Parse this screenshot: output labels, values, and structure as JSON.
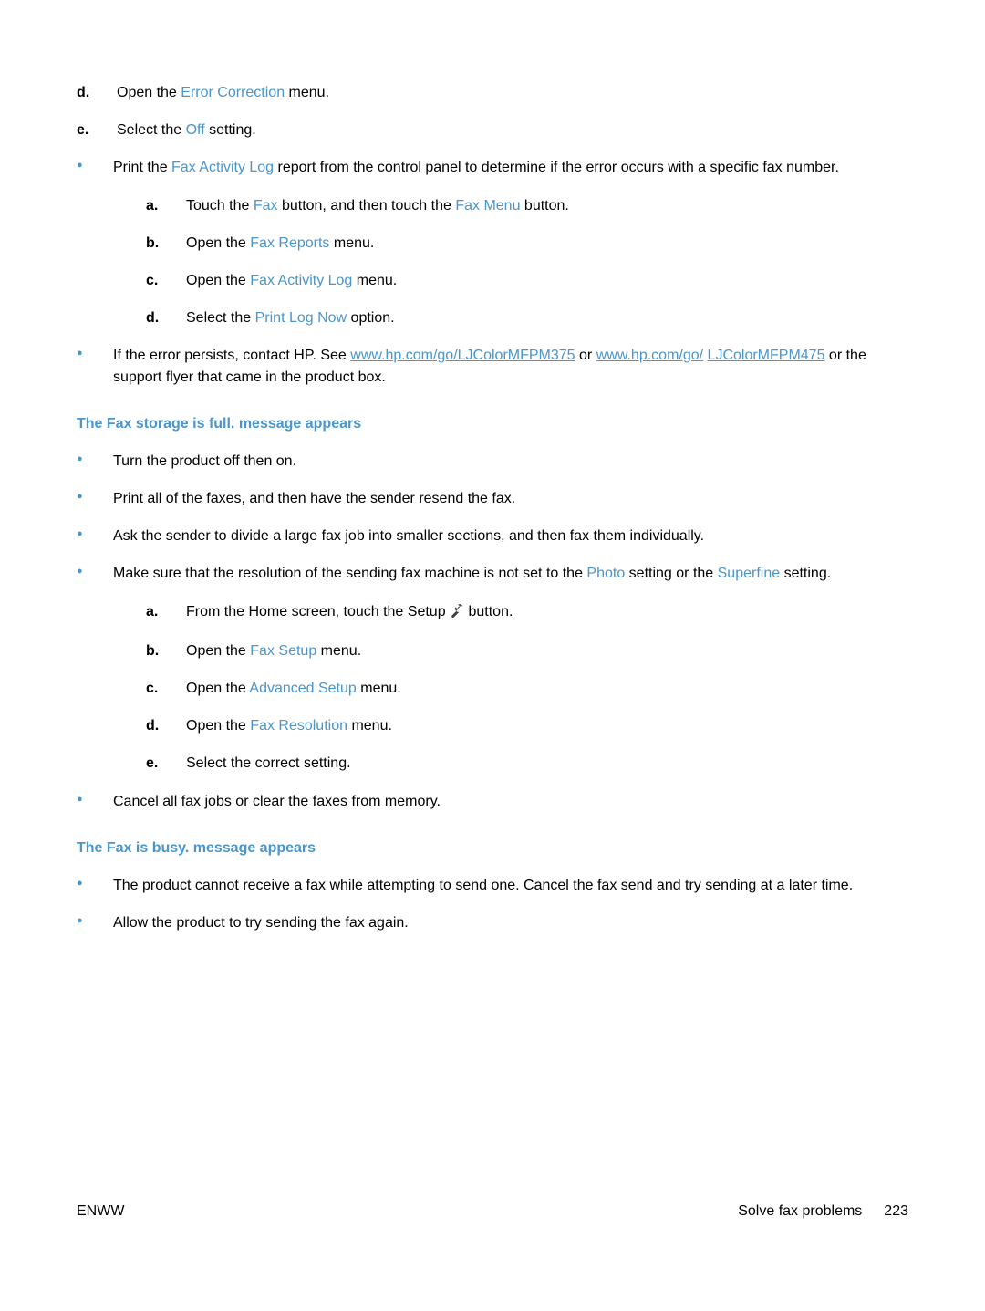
{
  "top_alpha": {
    "d": {
      "pre": "Open the ",
      "term": "Error Correction",
      "post": " menu."
    },
    "e": {
      "pre": "Select the ",
      "term": "Off",
      "post": " setting."
    }
  },
  "bullet_print": {
    "pre": "Print the ",
    "term": "Fax Activity Log",
    "post": " report from the control panel to determine if the error occurs with a specific fax number."
  },
  "print_alpha": {
    "a": {
      "pre": "Touch the ",
      "term1": "Fax",
      "mid": " button, and then touch the ",
      "term2": "Fax Menu",
      "post": " button."
    },
    "b": {
      "pre": "Open the ",
      "term": "Fax Reports",
      "post": " menu."
    },
    "c": {
      "pre": "Open the ",
      "term": "Fax Activity Log",
      "post": " menu."
    },
    "d": {
      "pre": "Select the ",
      "term": "Print Log Now",
      "post": " option."
    }
  },
  "bullet_contact": {
    "pre": "If the error persists, contact HP. See ",
    "link1": "www.hp.com/go/LJColorMFPM375",
    "mid": " or ",
    "link2a": "www.hp.com/go/",
    "link2b": "LJColorMFPM475",
    "post": " or the support flyer that came in the product box."
  },
  "heading_storage": "The Fax storage is full. message appears",
  "storage_bullets": {
    "b1": "Turn the product off then on.",
    "b2": "Print all of the faxes, and then have the sender resend the fax.",
    "b3": "Ask the sender to divide a large fax job into smaller sections, and then fax them individually.",
    "b4": {
      "pre": "Make sure that the resolution of the sending fax machine is not set to the ",
      "term1": "Photo",
      "mid": " setting or the ",
      "term2": "Superfine",
      "post": " setting."
    },
    "b5": "Cancel all fax jobs or clear the faxes from memory."
  },
  "storage_alpha": {
    "a": {
      "pre": "From the Home screen, touch the Setup ",
      "post": " button."
    },
    "b": {
      "pre": "Open the ",
      "term": "Fax Setup",
      "post": " menu."
    },
    "c": {
      "pre": "Open the ",
      "term": "Advanced Setup",
      "post": " menu."
    },
    "d": {
      "pre": "Open the ",
      "term": "Fax Resolution",
      "post": " menu."
    },
    "e": {
      "text": "Select the correct setting."
    }
  },
  "heading_busy": "The Fax is busy. message appears",
  "busy_bullets": {
    "b1": "The product cannot receive a fax while attempting to send one. Cancel the fax send and try sending at a later time.",
    "b2": "Allow the product to try sending the fax again."
  },
  "footer": {
    "left": "ENWW",
    "right_label": "Solve fax problems",
    "page": "223"
  }
}
